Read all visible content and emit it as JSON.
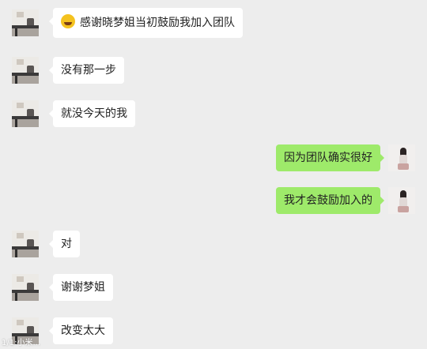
{
  "messages": [
    {
      "side": "in",
      "text": "感谢晓梦姐当初鼓励我加入团队",
      "emoji": "laughing-tears-icon"
    },
    {
      "side": "in",
      "text": "没有那一步"
    },
    {
      "side": "in",
      "text": "就没今天的我"
    },
    {
      "side": "out",
      "text": "因为团队确实很好"
    },
    {
      "side": "out",
      "text": "我才会鼓励加入的"
    },
    {
      "side": "in",
      "text": "对"
    },
    {
      "side": "in",
      "text": "谢谢梦姐"
    },
    {
      "side": "in",
      "text": "改变太大"
    }
  ],
  "watermark": "1/1:小米..."
}
